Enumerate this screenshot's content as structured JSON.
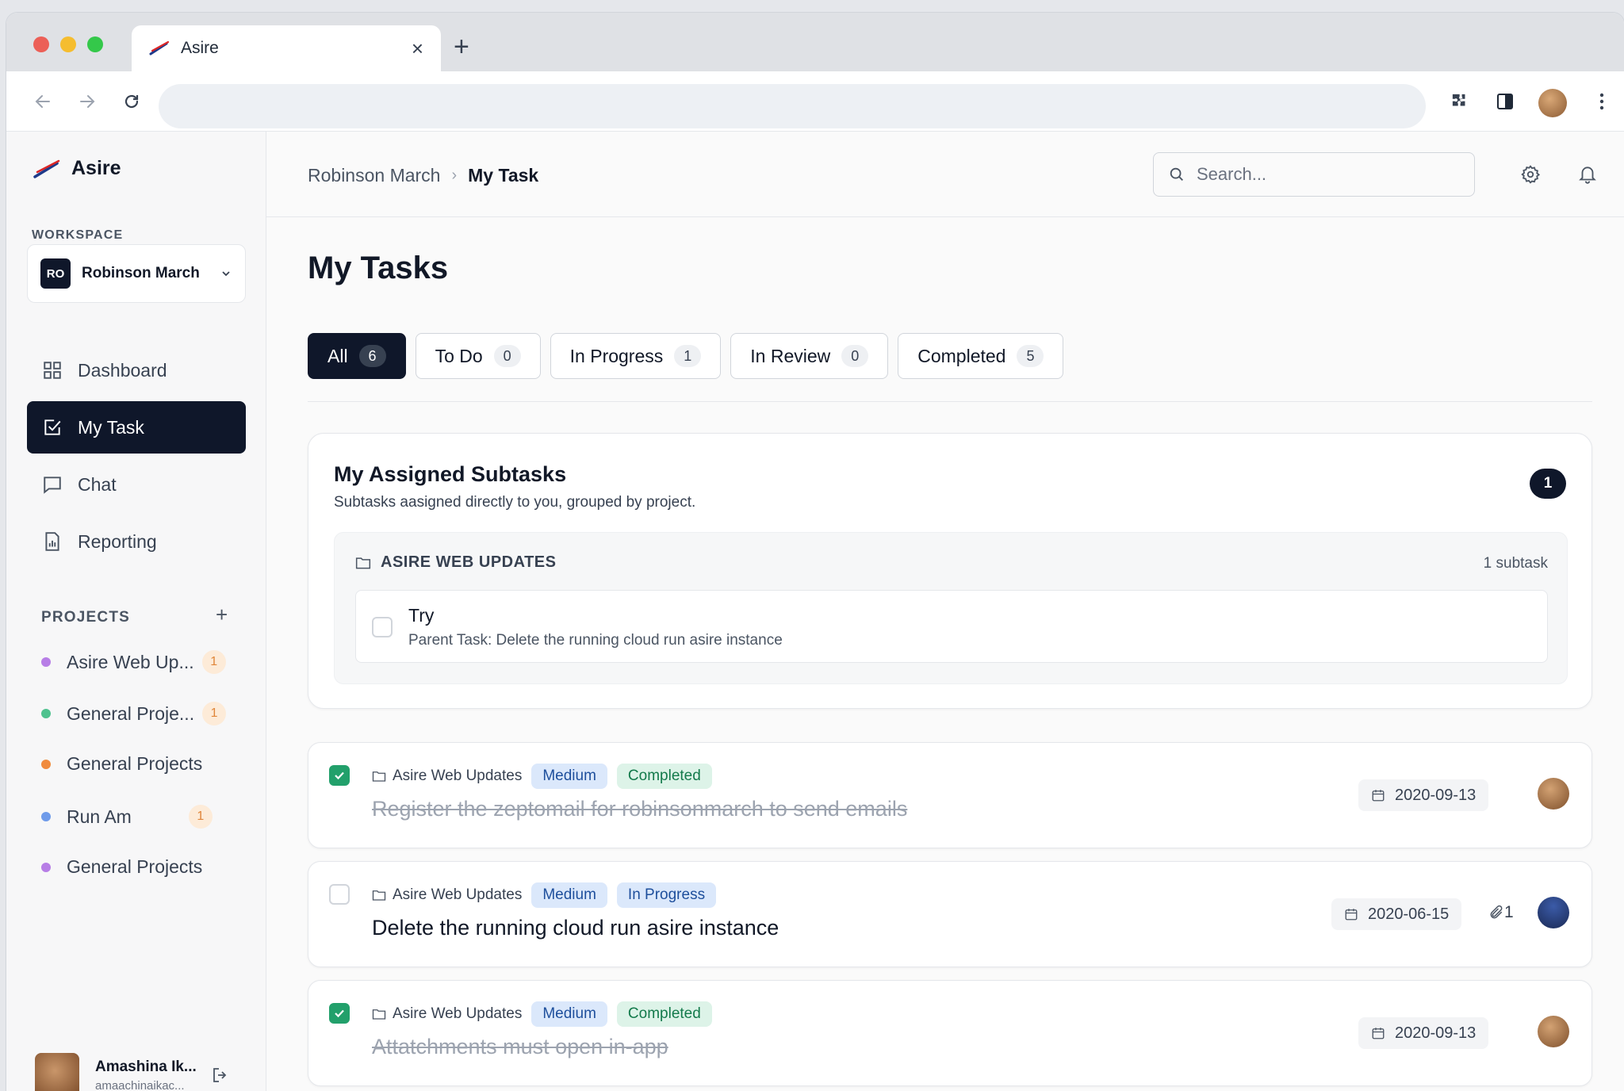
{
  "browser": {
    "tab_title": "Asire",
    "window_dots": [
      "#ec5f57",
      "#f5bd2f",
      "#34c84a"
    ]
  },
  "sidebar": {
    "brand": "Asire",
    "workspace_label": "WORKSPACE",
    "workspace": {
      "initials": "RO",
      "name": "Robinson March"
    },
    "nav": [
      {
        "label": "Dashboard",
        "icon": "grid-icon"
      },
      {
        "label": "My Task",
        "icon": "check-square-icon",
        "active": true
      },
      {
        "label": "Chat",
        "icon": "chat-icon"
      },
      {
        "label": "Reporting",
        "icon": "report-icon"
      }
    ],
    "projects_label": "PROJECTS",
    "projects": [
      {
        "name": "Asire Web Up...",
        "color": "#b77ee6",
        "count": "1"
      },
      {
        "name": "General Proje...",
        "color": "#4fc28f",
        "count": "1"
      },
      {
        "name": "General Projects",
        "color": "#f08b3e",
        "count": ""
      },
      {
        "name": "Run Am",
        "color": "#6f9bea",
        "count": "1"
      },
      {
        "name": "General Projects",
        "color": "#b77ee6",
        "count": ""
      }
    ],
    "user": {
      "name": "Amashina Ik...",
      "email": "amaachinaikac..."
    }
  },
  "header": {
    "breadcrumb": [
      "Robinson March",
      "My Task"
    ],
    "search_placeholder": "Search..."
  },
  "page": {
    "title": "My Tasks",
    "filters": [
      {
        "label": "All",
        "count": "6",
        "active": true
      },
      {
        "label": "To Do",
        "count": "0"
      },
      {
        "label": "In Progress",
        "count": "1"
      },
      {
        "label": "In Review",
        "count": "0"
      },
      {
        "label": "Completed",
        "count": "5"
      }
    ]
  },
  "subtasks": {
    "title": "My Assigned Subtasks",
    "description": "Subtasks aasigned directly to you, grouped by project.",
    "count": "1",
    "group": {
      "name": "ASIRE WEB UPDATES",
      "count_label": "1 subtask",
      "item": {
        "title": "Try",
        "parent": "Parent Task: Delete the running cloud run asire instance"
      }
    }
  },
  "tasks": [
    {
      "project": "Asire Web Updates",
      "priority": "Medium",
      "status": "Completed",
      "title": "Register the zeptomail for robinsonmarch to send emails",
      "date": "2020-09-13",
      "done": true,
      "attachments": ""
    },
    {
      "project": "Asire Web Updates",
      "priority": "Medium",
      "status": "In Progress",
      "title": "Delete the running cloud run asire instance",
      "date": "2020-06-15",
      "done": false,
      "attachments": "1"
    },
    {
      "project": "Asire Web Updates",
      "priority": "Medium",
      "status": "Completed",
      "title": "Attatchments must open in-app",
      "date": "2020-09-13",
      "done": true,
      "attachments": ""
    }
  ]
}
